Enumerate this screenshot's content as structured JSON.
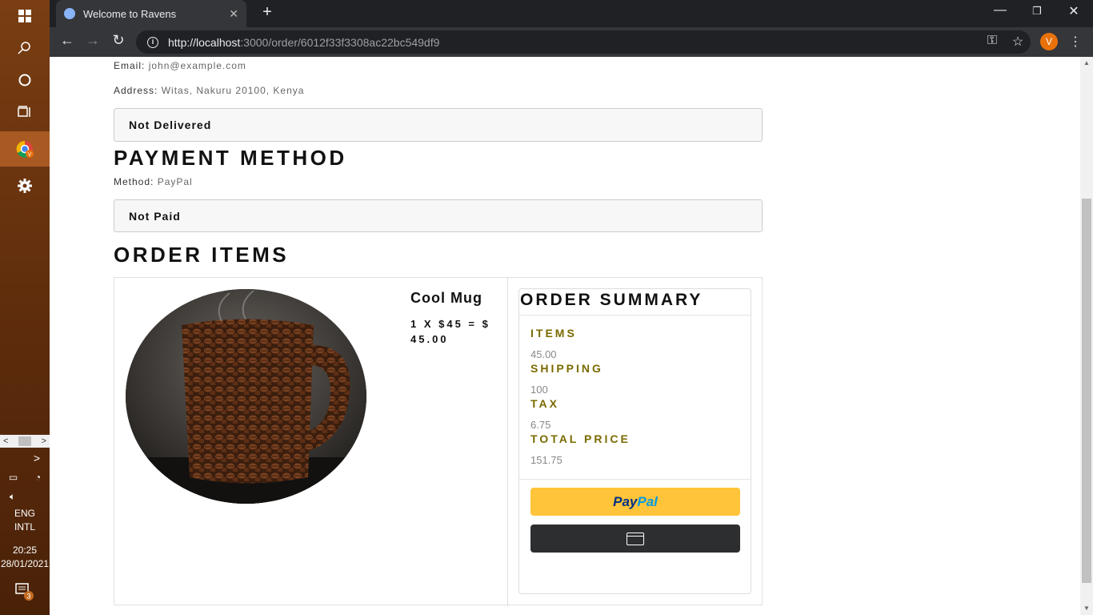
{
  "taskbar": {
    "lang": "ENG",
    "layout": "INTL",
    "time": "20:25",
    "date": "28/01/2021",
    "notification_count": "3"
  },
  "browser": {
    "tab_title": "Welcome to Ravens",
    "url_host": "http://localhost",
    "url_path": ":3000/order/6012f33f3308ac22bc549df9",
    "profile_initial": "V"
  },
  "shipping": {
    "email_label": "Email: ",
    "email": "john@example.com",
    "address_label": "Address: ",
    "address": "Witas, Nakuru 20100, Kenya",
    "status": "Not Delivered"
  },
  "payment": {
    "heading": "PAYMENT METHOD",
    "method_label": "Method: ",
    "method": "PayPal",
    "status": "Not Paid"
  },
  "order_items": {
    "heading": "ORDER ITEMS",
    "items": [
      {
        "name": "Cool Mug",
        "qty_line": "1 X $45 = $ 45.00"
      }
    ]
  },
  "summary": {
    "heading": "ORDER SUMMARY",
    "items_label": "ITEMS",
    "items_value": "45.00",
    "shipping_label": "SHIPPING",
    "shipping_value": "100",
    "tax_label": "TAX",
    "tax_value": "6.75",
    "total_label": "TOTAL PRICE",
    "total_value": "151.75",
    "paypal_pay": "Pay",
    "paypal_pal": "Pal"
  }
}
